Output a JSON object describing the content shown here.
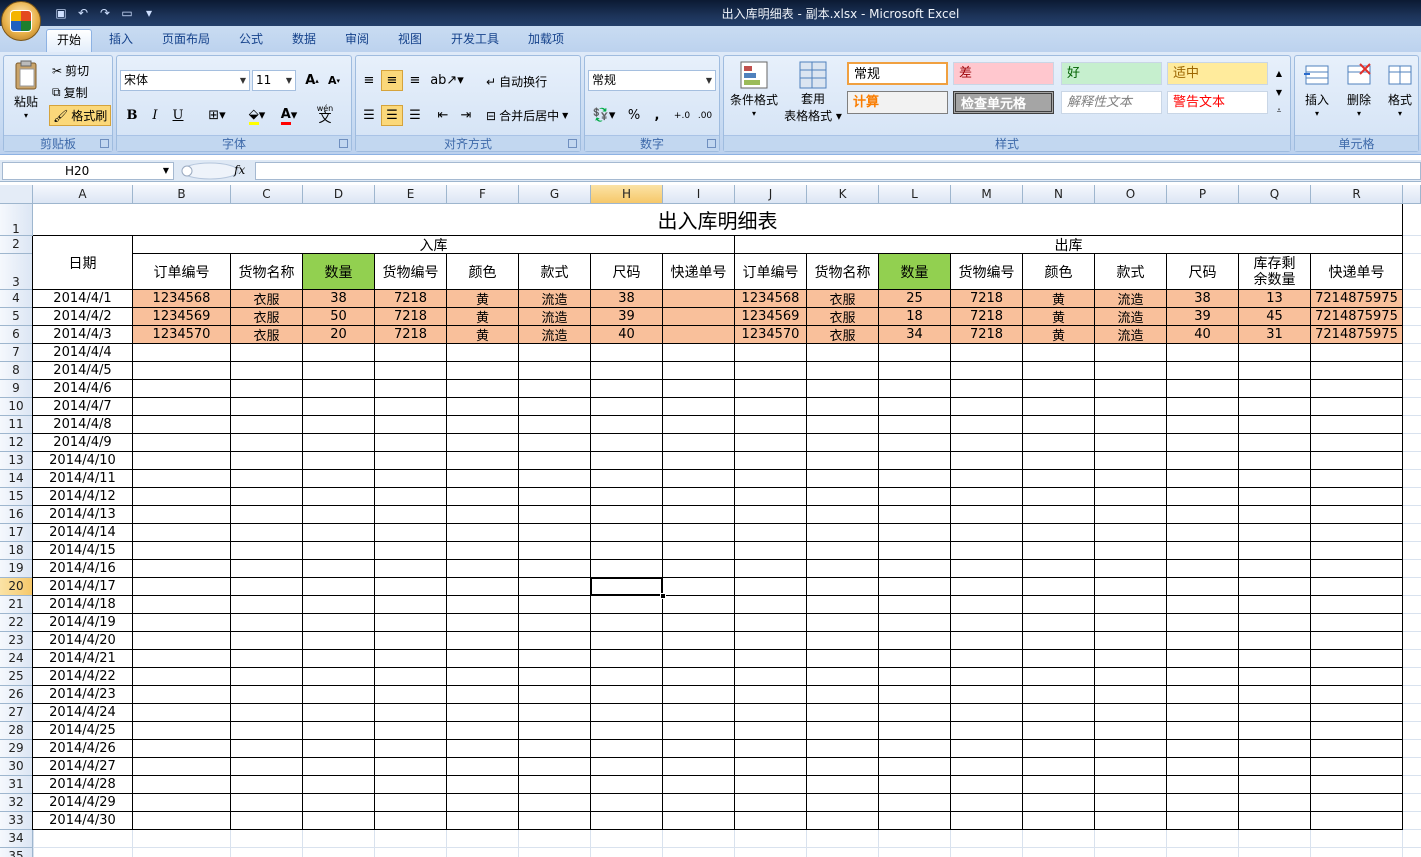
{
  "window": {
    "title": "出入库明细表 - 副本.xlsx - Microsoft Excel"
  },
  "ribbon": {
    "tabs": [
      "开始",
      "插入",
      "页面布局",
      "公式",
      "数据",
      "审阅",
      "视图",
      "开发工具",
      "加载项"
    ],
    "clipboard": {
      "label": "剪贴板",
      "paste": "粘贴",
      "cut": "剪切",
      "copy": "复制",
      "format_painter": "格式刷"
    },
    "font": {
      "label": "字体",
      "font_name": "宋体",
      "font_size": "11",
      "bold": "B",
      "italic": "I",
      "underline": "U",
      "wen": "wén",
      "wen2": "文"
    },
    "alignment": {
      "label": "对齐方式",
      "wrap_text": "自动换行",
      "merge_center": "合并后居中"
    },
    "number": {
      "label": "数字",
      "format": "常规",
      "percent": "%",
      "comma": ","
    },
    "styles": {
      "label": "样式",
      "conditional_format": "条件格式",
      "table_format_1": "套用",
      "table_format_2": "表格格式",
      "cells": [
        {
          "name": "常规",
          "color": "#000000",
          "bg": "#ffffff"
        },
        {
          "name": "差",
          "color": "#9c0006",
          "bg": "#ffc7ce"
        },
        {
          "name": "好",
          "color": "#006100",
          "bg": "#c6efce"
        },
        {
          "name": "适中",
          "color": "#9c6500",
          "bg": "#ffeb9c"
        },
        {
          "name": "计算",
          "color": "#fa7d00",
          "bg": "#f2f2f2"
        },
        {
          "name": "检查单元格",
          "color": "#ffffff",
          "bg": "#a5a5a5"
        },
        {
          "name": "解释性文本",
          "color": "#7f7f7f",
          "bg": "#ffffff"
        },
        {
          "name": "警告文本",
          "color": "#ff0000",
          "bg": "#ffffff"
        }
      ]
    },
    "cells_group": {
      "label": "单元格",
      "insert": "插入",
      "delete": "删除",
      "format": "格式"
    }
  },
  "formula_bar": {
    "name_box": "H20",
    "fx": "fx",
    "value": ""
  },
  "sheet": {
    "columns": [
      "A",
      "B",
      "C",
      "D",
      "E",
      "F",
      "G",
      "H",
      "I",
      "J",
      "K",
      "L",
      "M",
      "N",
      "O",
      "P",
      "Q",
      "R"
    ],
    "selected_column": "H",
    "selected_row": "20",
    "title": "出入库明细表",
    "date_header": "日期",
    "in_header": "入库",
    "out_header": "出库",
    "in_columns": [
      "订单编号",
      "货物名称",
      "数量",
      "货物编号",
      "颜色",
      "款式",
      "尺码",
      "快递单号"
    ],
    "out_columns": [
      "订单编号",
      "货物名称",
      "数量",
      "货物编号",
      "颜色",
      "款式",
      "尺码",
      "库存剩余数量",
      "快递单号"
    ],
    "data_rows": [
      {
        "date": "2014/4/1",
        "in": [
          "1234568",
          "衣服",
          "38",
          "7218",
          "黄",
          "流造",
          "38",
          ""
        ],
        "out": [
          "1234568",
          "衣服",
          "25",
          "7218",
          "黄",
          "流造",
          "38",
          "13",
          "7214875975"
        ]
      },
      {
        "date": "2014/4/2",
        "in": [
          "1234569",
          "衣服",
          "50",
          "7218",
          "黄",
          "流造",
          "39",
          ""
        ],
        "out": [
          "1234569",
          "衣服",
          "18",
          "7218",
          "黄",
          "流造",
          "39",
          "45",
          "7214875975"
        ]
      },
      {
        "date": "2014/4/3",
        "in": [
          "1234570",
          "衣服",
          "20",
          "7218",
          "黄",
          "流造",
          "40",
          ""
        ],
        "out": [
          "1234570",
          "衣服",
          "34",
          "7218",
          "黄",
          "流造",
          "40",
          "31",
          "7214875975"
        ]
      }
    ],
    "empty_dates": [
      "2014/4/4",
      "2014/4/5",
      "2014/4/6",
      "2014/4/7",
      "2014/4/8",
      "2014/4/9",
      "2014/4/10",
      "2014/4/11",
      "2014/4/12",
      "2014/4/13",
      "2014/4/14",
      "2014/4/15",
      "2014/4/16",
      "2014/4/17",
      "2014/4/18",
      "2014/4/19",
      "2014/4/20",
      "2014/4/21",
      "2014/4/22",
      "2014/4/23",
      "2014/4/24",
      "2014/4/25",
      "2014/4/26",
      "2014/4/27",
      "2014/4/28",
      "2014/4/29",
      "2014/4/30"
    ],
    "row_numbers": [
      "1",
      "2",
      "3",
      "4",
      "5",
      "6",
      "7",
      "8",
      "9",
      "10",
      "11",
      "12",
      "13",
      "14",
      "15",
      "16",
      "17",
      "18",
      "19",
      "20",
      "21",
      "22",
      "23",
      "24",
      "25",
      "26",
      "27",
      "28",
      "29",
      "30",
      "31",
      "32",
      "33",
      "34",
      "35"
    ]
  }
}
